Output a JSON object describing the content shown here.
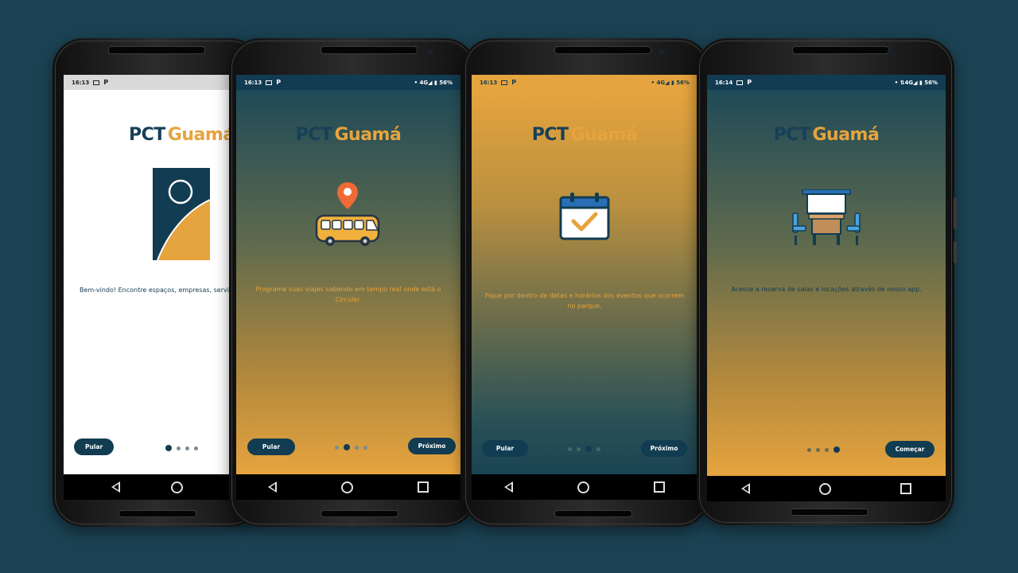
{
  "brand": {
    "pct": "PCT",
    "guama": "Guamá"
  },
  "screens": [
    {
      "time": "16:13",
      "status_right": "",
      "message": "Bem-vindo! Encontre espaços, empresas, servi",
      "skip_label": "Pular",
      "next_label": "",
      "active_dot": 1,
      "illustration": "pct-guama-emblem-icon"
    },
    {
      "time": "16:13",
      "status_right": "• 4G◢ ▮ 56%",
      "message": "Programe suas viajes sabendo em tempo real onde está o Circular.",
      "skip_label": "Pular",
      "next_label": "Próximo",
      "active_dot": 2,
      "illustration": "bus-location-icon"
    },
    {
      "time": "16:13",
      "status_right": "• 4G◢ ▮ 56%",
      "message": "Fique por dentro de datas e horários dos eventos que ocorrem no parque.",
      "skip_label": "Pular",
      "next_label": "Próximo",
      "active_dot": 3,
      "illustration": "calendar-check-icon"
    },
    {
      "time": "16:14",
      "status_right": "• ⇅4G◢ ▮ 56%",
      "message": "Acesse a reserva de salas e locações através de nosso app.",
      "skip_label": "",
      "next_label": "Começar",
      "active_dot": 4,
      "illustration": "meeting-room-icon"
    }
  ],
  "colors": {
    "brand_navy": "#123c52",
    "brand_gold": "#e6a43e",
    "background": "#1b4253"
  }
}
